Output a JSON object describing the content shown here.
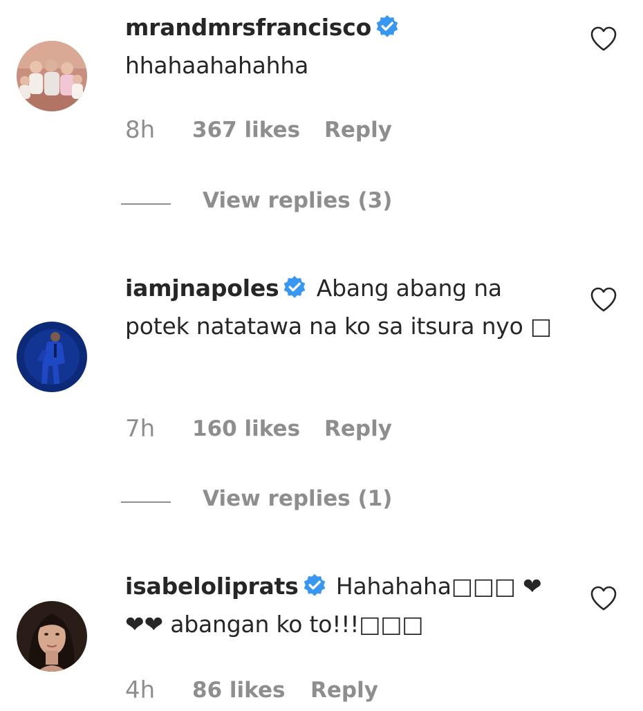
{
  "comments": [
    {
      "username": "mrandmrsfrancisco",
      "verified": true,
      "text": "hhahaahahahha",
      "time": "8h",
      "likes": "367 likes",
      "reply_label": "Reply",
      "view_replies": "View replies (3)",
      "avatar_icon": "family-photo-avatar"
    },
    {
      "username": "iamjnapoles",
      "verified": true,
      "text": "Abang abang na potek natatawa na ko sa itsura nyo □",
      "time": "7h",
      "likes": "160 likes",
      "reply_label": "Reply",
      "view_replies": "View replies (1)",
      "avatar_icon": "man-in-blue-suit-avatar"
    },
    {
      "username": "isabeloliprats",
      "verified": true,
      "text": "Hahahaha□□□ ❤❤❤ abangan ko to!!!□□□",
      "time": "4h",
      "likes": "86 likes",
      "reply_label": "Reply",
      "avatar_icon": "woman-portrait-avatar"
    }
  ],
  "colors": {
    "text": "#262626",
    "secondary": "#8e8e8e",
    "verified_badge": "#3897f0",
    "background": "#ffffff"
  }
}
